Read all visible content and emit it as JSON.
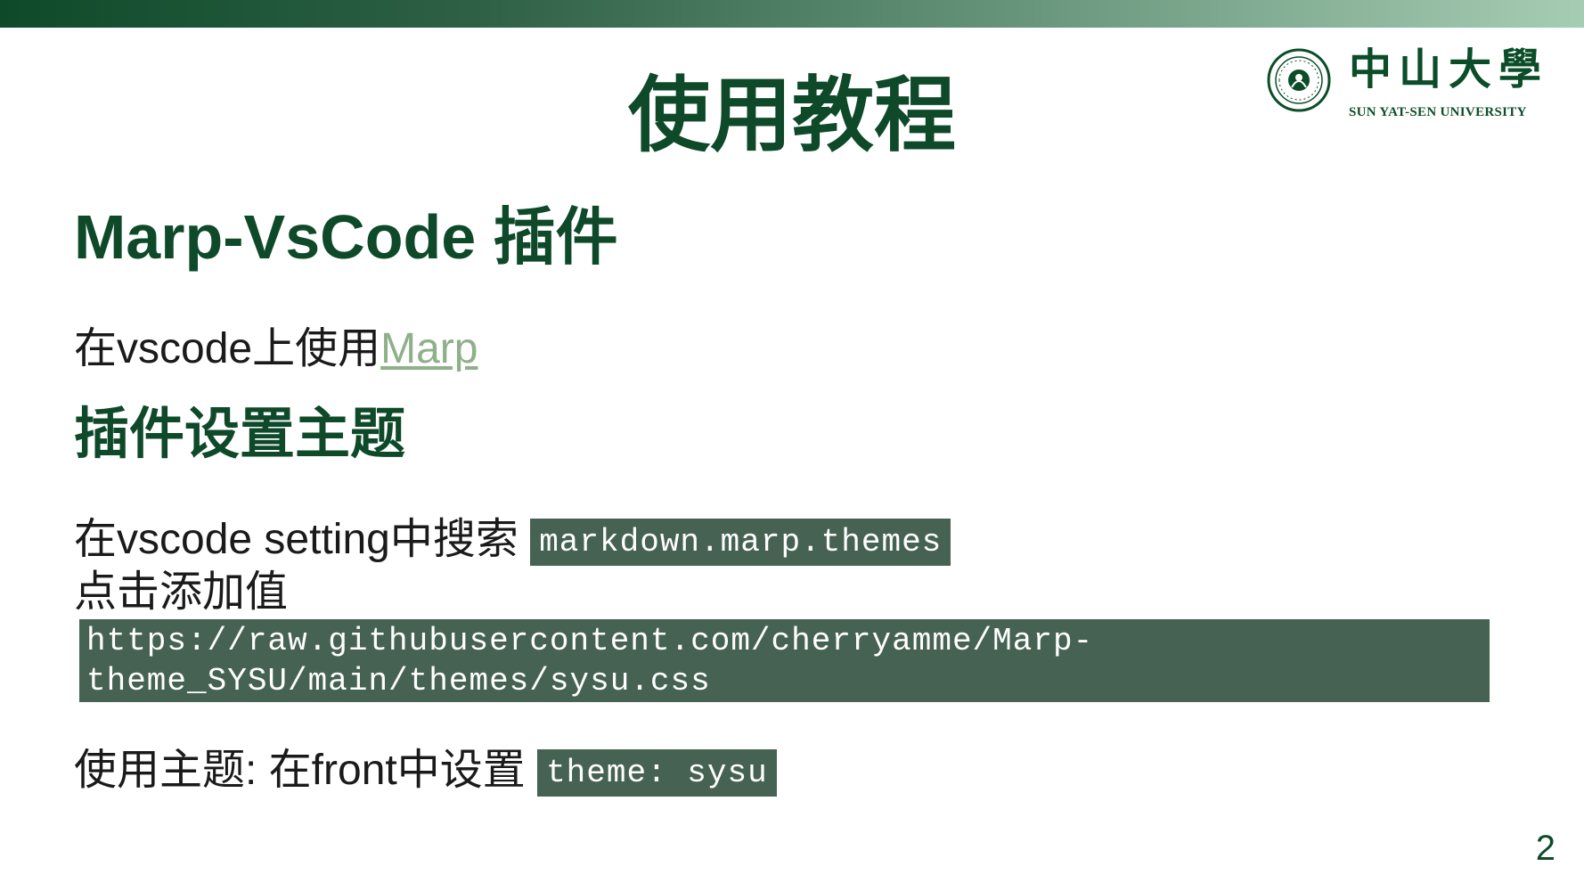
{
  "slide": {
    "title": "使用教程",
    "heading": "Marp-VsCode 插件",
    "line1_prefix": "在vscode上使用",
    "line1_link": "Marp",
    "subheading": "插件设置主题",
    "line2_prefix": "在vscode setting中搜索",
    "line2_code": "markdown.marp.themes",
    "line3": "点击添加值",
    "code_block_lines": [
      "https://raw.githubusercontent.com/cherryamme/Marp-",
      "theme_SYSU/main/themes/sysu.css"
    ],
    "line4_prefix": "使用主题: 在front中设置",
    "line4_code": "theme: sysu",
    "page_number": "2"
  },
  "logo": {
    "chinese_name": "中山大學",
    "english_name": "SUN YAT-SEN UNIVERSITY",
    "seal_icon": "university-seal-icon"
  },
  "colors": {
    "primary_green": "#0e4a2a",
    "code_background": "#456252",
    "link_color": "#8fb08a"
  }
}
